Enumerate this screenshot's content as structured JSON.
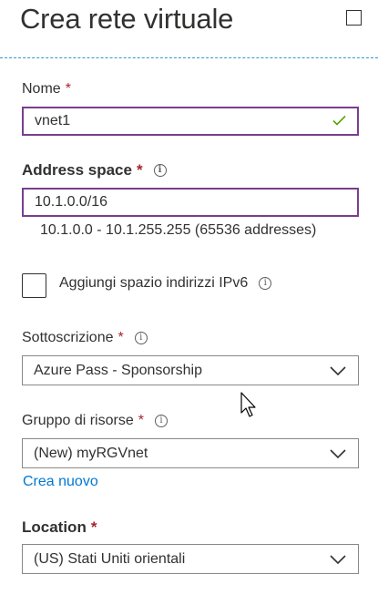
{
  "header": {
    "title": "Crea rete virtuale"
  },
  "name_field": {
    "label": "Nome",
    "required_mark": "*",
    "value": "vnet1",
    "valid_icon": "checkmark-icon"
  },
  "address_space": {
    "label": "Address space",
    "required_mark": "*",
    "info_glyph": "i",
    "value": "10.1.0.0/16",
    "range_text": "10.1.0.0 - 10.1.255.255 (65536 addresses)"
  },
  "ipv6": {
    "label": "Aggiungi spazio indirizzi IPv6",
    "info_glyph": "i",
    "checked": false
  },
  "subscription": {
    "label": "Sottoscrizione",
    "required_mark": "*",
    "info_glyph": "i",
    "selected": "Azure Pass - Sponsorship"
  },
  "resource_group": {
    "label": "Gruppo di risorse",
    "required_mark": "*",
    "info_glyph": "i",
    "selected": "(New) myRGVnet",
    "create_new_link": "Crea nuovo"
  },
  "location": {
    "label": "Location",
    "required_mark": "*",
    "selected": "(US) Stati Uniti orientali"
  },
  "colors": {
    "accent_link": "#0078d4",
    "required": "#a4262c",
    "focused_border": "#7a3e8e",
    "valid": "#57a300",
    "divider": "#2b9ad8"
  }
}
